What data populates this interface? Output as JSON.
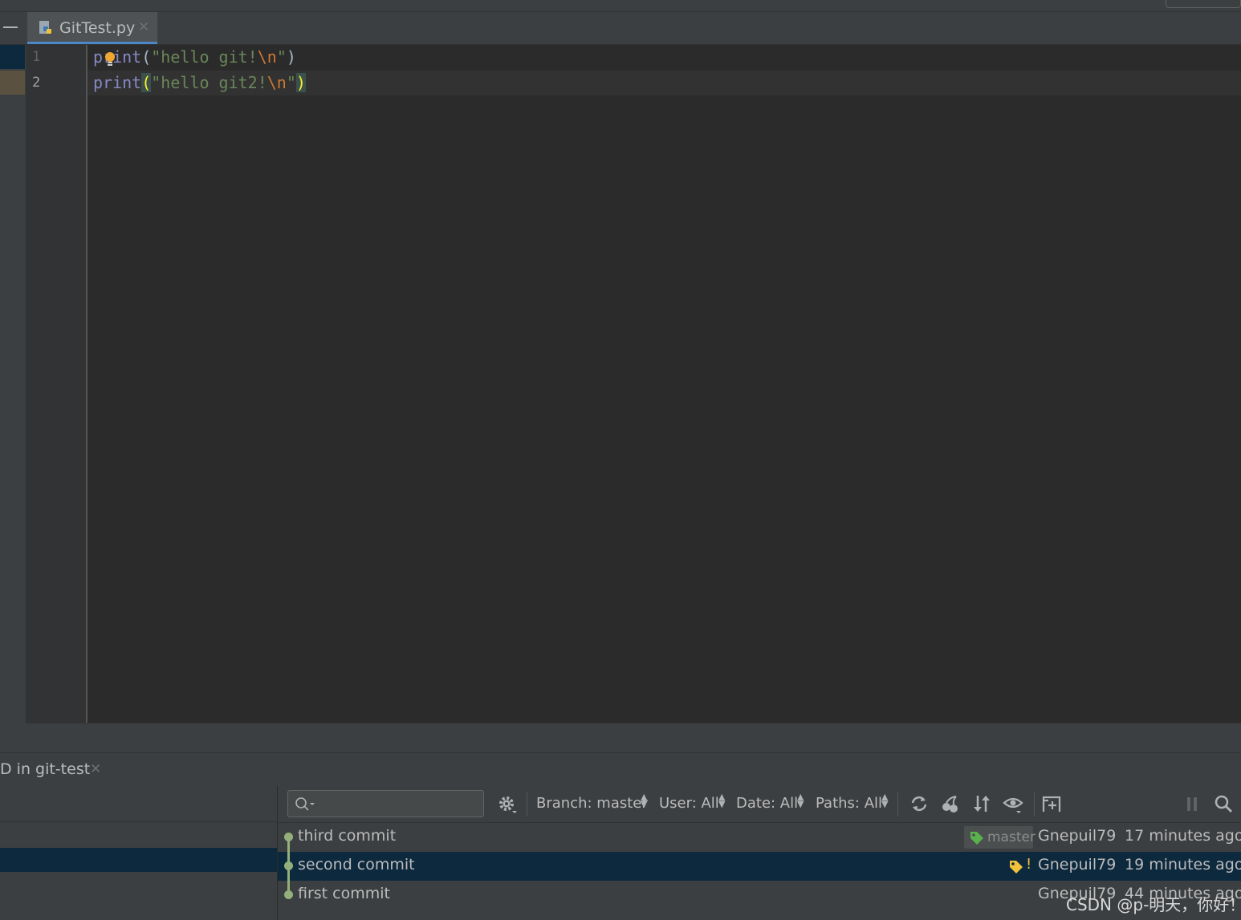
{
  "editor": {
    "tab_title": "GitTest.py",
    "line_numbers": [
      "1",
      "2"
    ],
    "lines": [
      {
        "fn": "print",
        "open": "(",
        "str_open": "\"hello git!",
        "escape": "\\n",
        "str_close": "\"",
        "close": ")"
      },
      {
        "fn": "print",
        "open": "(",
        "str_open": "\"hello git2!",
        "escape": "\\n",
        "str_close": "\"",
        "close": ")"
      }
    ]
  },
  "panel": {
    "title": "D in git-test",
    "toolbar": {
      "branch_label": "Branch: master",
      "user_label": "User: All",
      "date_label": "Date: All",
      "paths_label": "Paths: All",
      "search_placeholder": ""
    },
    "commits": [
      {
        "message": "third commit",
        "ref": "master",
        "author": "Gnepuil79",
        "date": "17 minutes ago"
      },
      {
        "message": "second commit",
        "ref_mark": "!",
        "author": "Gnepuil79",
        "date": "19 minutes ago"
      },
      {
        "message": "first commit",
        "author": "Gnepuil79",
        "date": "44 minutes ago"
      }
    ]
  },
  "watermark": "CSDN @p-明天，你好！",
  "icons": [
    "minimize-icon",
    "python-file-icon",
    "close-icon",
    "bulb-icon",
    "search-icon",
    "gear-icon",
    "refresh-icon",
    "cherry-pick-icon",
    "sort-icon",
    "eye-icon",
    "new-tab-icon",
    "pause-icon",
    "tag-icon"
  ],
  "colors": {
    "accent": "#4a88c7",
    "selection": "#0d293e",
    "graph": "#94b07a",
    "tag_green": "#5bb14d",
    "tag_yellow": "#f0c23c"
  }
}
